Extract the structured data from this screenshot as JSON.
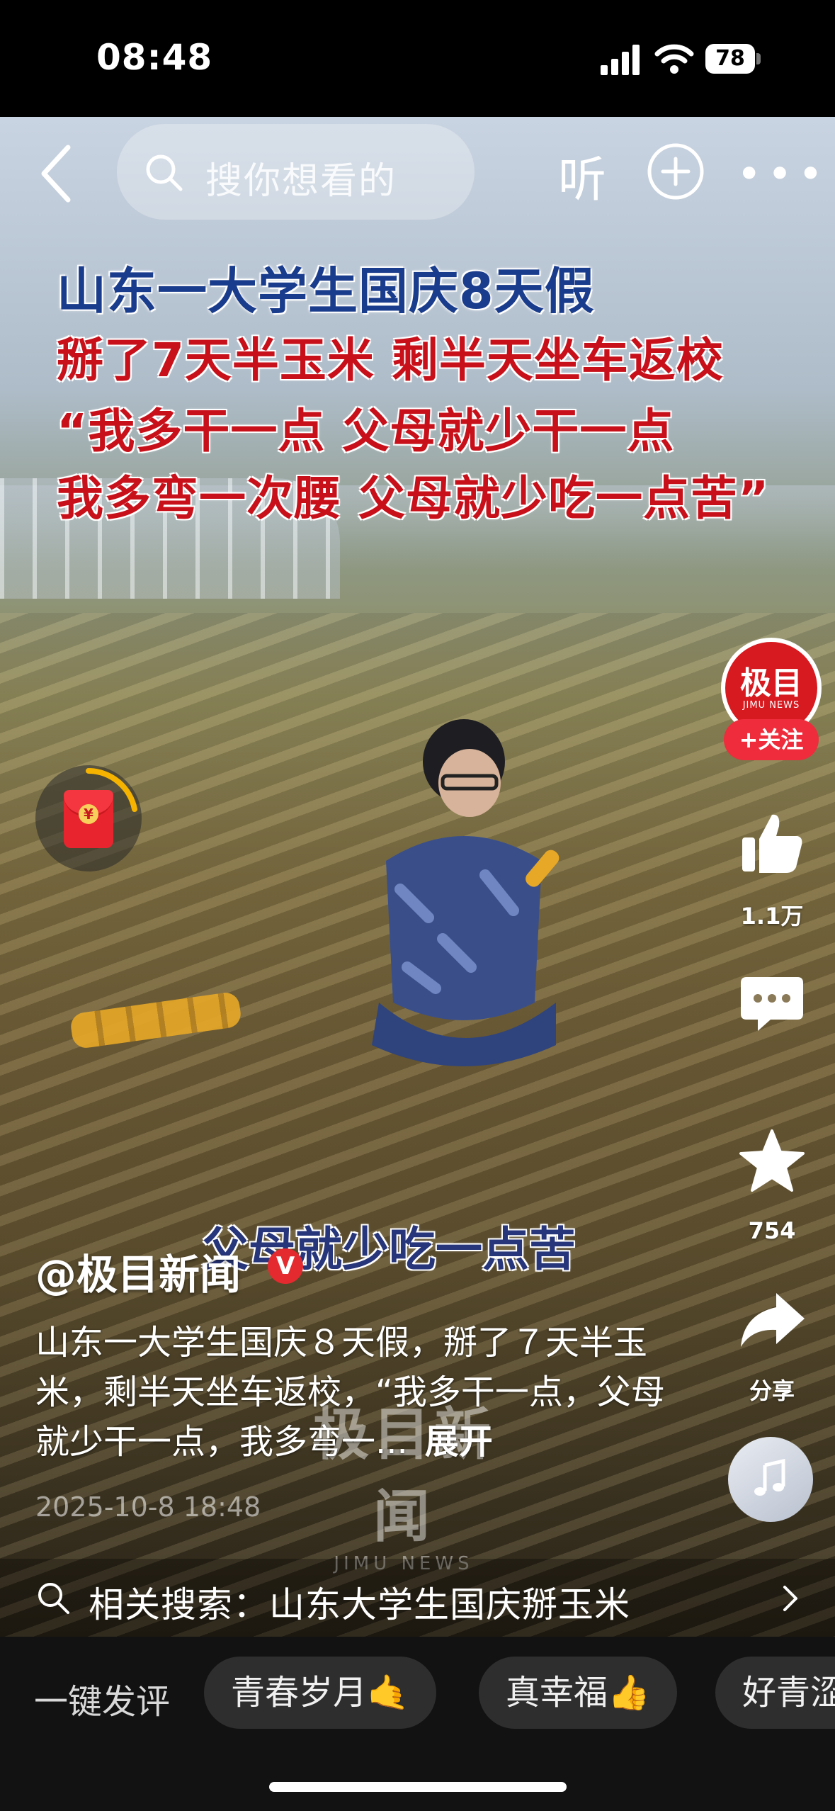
{
  "status_bar": {
    "time": "08:48",
    "battery": "78"
  },
  "nav": {
    "search_placeholder": "搜你想看的",
    "listen_label": "听"
  },
  "video": {
    "headline_lines": [
      "山东一大学生国庆8天假",
      "掰了7天半玉米  剩半天坐车返校",
      "“我多干一点  父母就少干一点",
      "我多弯一次腰  父母就少吃一点苦”"
    ],
    "subtitle": "父母就少吃一点苦",
    "watermark_main": "极目新闻",
    "watermark_sub": "JIMU NEWS"
  },
  "right_rail": {
    "avatar_logo": "极目",
    "avatar_sub": "JIMU NEWS",
    "follow_label": "+关注",
    "like_count": "1.1万",
    "comment_count": "",
    "favorite_count": "754",
    "share_label": "分享"
  },
  "post": {
    "author": "@极目新闻",
    "verified_badge": "V",
    "description": "山东一大学生国庆８天假，掰了７天半玉米，剩半天坐车返校，“我多干一点，父母就少干一点，我多弯一...",
    "expand_label": "展开",
    "date": "2025-10-8 18:48"
  },
  "related_search": {
    "label": "相关搜索：山东大学生国庆掰玉米"
  },
  "quick_comment": {
    "label": "一键发评",
    "chips": [
      "青春岁月🤙",
      "真幸福👍",
      "好青涩"
    ]
  },
  "colors": {
    "brand_red": "#d71a20",
    "follow_red": "#ee2c3c",
    "headline_blue": "#1a3c8c",
    "headline_red": "#c8101a"
  },
  "icons": [
    "back-icon",
    "search-icon",
    "plus-circle-icon",
    "more-icon",
    "red-packet-icon",
    "like-icon",
    "comment-icon",
    "star-icon",
    "share-icon",
    "music-icon",
    "chevron-right-icon"
  ]
}
